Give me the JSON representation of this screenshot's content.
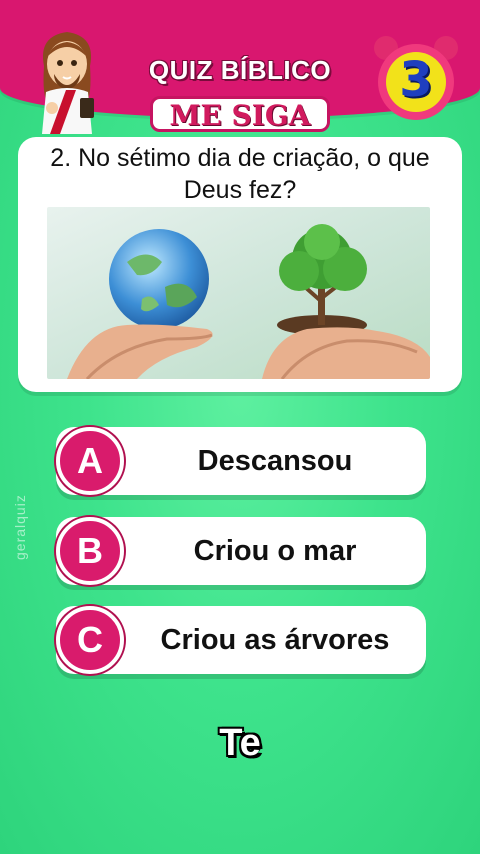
{
  "header": {
    "title": "QUIZ BÍBLICO",
    "brand": "ME SIGA",
    "timer_value": "3"
  },
  "question": {
    "text": "2. No sétimo dia de criação, o que Deus fez?"
  },
  "options": [
    {
      "letter": "A",
      "text": "Descansou"
    },
    {
      "letter": "B",
      "text": "Criou o mar"
    },
    {
      "letter": "C",
      "text": "Criou as árvores"
    }
  ],
  "watermark": "geralquiz",
  "countdown_text": "Te",
  "colors": {
    "header": "#d9176f",
    "badge": "#d91b6c",
    "background": "#3ee38c",
    "timer_fill": "#f2e21a",
    "timer_digit": "#1f3fbf"
  },
  "icons": [
    "jesus-avatar-icon",
    "alarm-clock-icon"
  ]
}
